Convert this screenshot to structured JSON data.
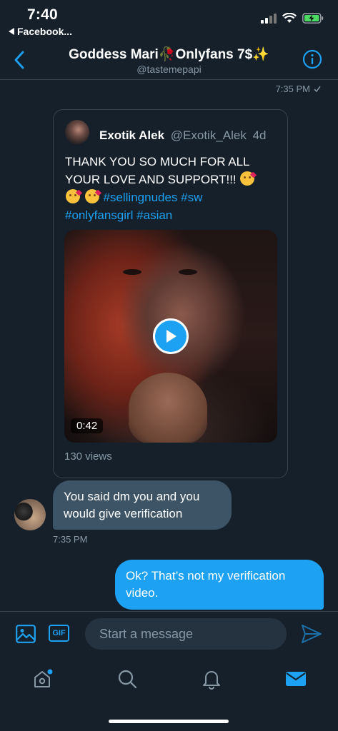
{
  "status_bar": {
    "time": "7:40",
    "back_to_app": "Facebook..."
  },
  "header": {
    "title": "Goddess Mari🥀Onlyfans 7$✨",
    "handle": "@tastemepapi"
  },
  "conversation": {
    "top_timestamp": "7:35 PM",
    "shared_tweet": {
      "author_name": "Exotik Alek",
      "author_handle": "@Exotik_Alek",
      "age": "4d",
      "text_line1": "THANK YOU SO MUCH FOR ALL",
      "text_line2": "YOUR LOVE AND SUPPORT!!!",
      "hashtags_line3": "#sellingnudes #sw",
      "hashtags_line4": "#onlyfansgirl #asian",
      "video_duration": "0:42",
      "views": "130 views"
    },
    "received_message": {
      "text": "You said dm you and you would give verification",
      "time": "7:35 PM"
    },
    "sent_message": {
      "text": "Ok? That’s not my verification video."
    }
  },
  "composer": {
    "gif_label": "GIF",
    "placeholder": "Start a message"
  },
  "colors": {
    "background": "#15202b",
    "accent": "#1da1f2",
    "received_bubble": "#3d5466",
    "muted_text": "#8899a6"
  },
  "tabs": [
    {
      "icon": "home-icon"
    },
    {
      "icon": "search-icon"
    },
    {
      "icon": "notifications-bell-icon"
    },
    {
      "icon": "messages-envelope-icon"
    }
  ]
}
